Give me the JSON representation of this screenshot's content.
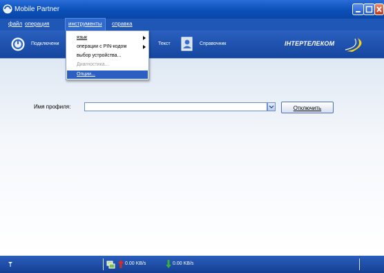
{
  "window": {
    "title": "Mobile Partner"
  },
  "menubar": {
    "items": [
      "файл",
      "операция",
      "инструменты",
      "справка"
    ]
  },
  "toolbar": {
    "connect_label": "Подключени",
    "text_label": "Текст",
    "phonebook_label": "Справочник",
    "brand": "ІНТЕРТЕЛЕКОМ"
  },
  "tools_menu": {
    "items": [
      {
        "label": "язык",
        "submenu": true,
        "state": "normal"
      },
      {
        "label": "операции с PIN-кодом",
        "submenu": true,
        "state": "normal"
      },
      {
        "label": "выбор устройства...",
        "submenu": false,
        "state": "normal"
      },
      {
        "label": "Диагностика...",
        "submenu": false,
        "state": "disabled"
      },
      {
        "label": "Опции...",
        "submenu": false,
        "state": "selected"
      }
    ]
  },
  "main": {
    "profile_label": "Имя профиля:",
    "profile_value": "",
    "disconnect_label": "Отключить"
  },
  "statusbar": {
    "upload_speed": "0.00 KB/s",
    "download_speed": "0.00 KB/s"
  },
  "colors": {
    "titlebar": "#0b4fb8",
    "menu_highlight": "#2b5fc1",
    "brand_accent": "#f2d21f",
    "upload_arrow": "#e02a1f",
    "download_arrow": "#36b23a"
  }
}
